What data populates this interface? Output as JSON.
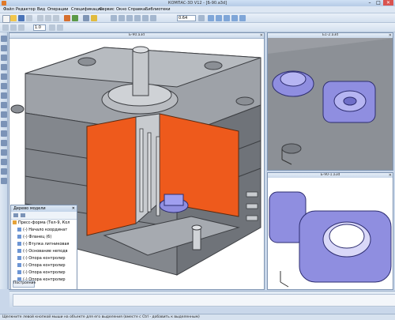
{
  "window": {
    "title": "КОМПАС-3D V12 - [Б-90.a3d]",
    "controls": {
      "minimize": "–",
      "maximize": "□",
      "close": "✕"
    }
  },
  "menu": {
    "items": [
      "Файл",
      "Редактор",
      "Вид",
      "Операции",
      "Спецификация",
      "Сервис",
      "Окно",
      "Справка",
      "Библиотеки"
    ]
  },
  "toolbar": {
    "zoom_value": "0.64",
    "step_value": "1.0"
  },
  "viewports": {
    "main": {
      "title": "Б-90.a3d"
    },
    "top_right": {
      "title": "Б1-2.a3d"
    },
    "bottom_right": {
      "title": "Б-90-1.a3d"
    }
  },
  "tree": {
    "title": "Дерево модели",
    "rows": [
      {
        "label": "Пресс-форма (Тел-9, Кол",
        "indent": 0
      },
      {
        "label": "(-) Начало координат",
        "indent": 1
      },
      {
        "label": "(-) Фланец",
        "suffix": "(6)",
        "indent": 1
      },
      {
        "label": "(-) Втулка литниковая",
        "indent": 1
      },
      {
        "label": "(-) Основание неподв",
        "indent": 1
      },
      {
        "label": "(-) Опора контролир",
        "indent": 1
      },
      {
        "label": "(-) Опора контролир",
        "indent": 1
      },
      {
        "label": "(-) Опора контролир",
        "indent": 1
      },
      {
        "label": "(-) Опора контролир",
        "indent": 1
      }
    ],
    "tab_label": "Построение"
  },
  "status": {
    "text": "Щелкните левой кнопкой мыши на объекте для его выделения (вместе с Ctrl - добавить к выделенным)"
  },
  "colors": {
    "accent_orange": "#ee5a1c",
    "model_gray": "#8d9197",
    "part_blue": "#8f8ee0"
  }
}
